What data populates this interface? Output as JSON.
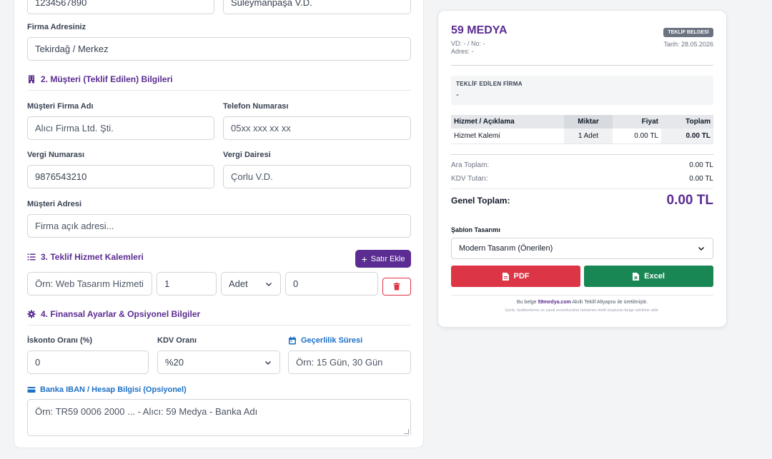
{
  "form": {
    "top_inputs": {
      "tax_number": "1234567890",
      "tax_office": "Süleymanpaşa V.D."
    },
    "company_address": {
      "label": "Firma Adresiniz",
      "value": "Tekirdağ / Merkez"
    },
    "section2": {
      "title": "2. Müşteri (Teklif Edilen) Bilgileri",
      "client_name": {
        "label": "Müşteri Firma Adı",
        "placeholder": "Alıcı Firma Ltd. Şti."
      },
      "phone": {
        "label": "Telefon Numarası",
        "placeholder": "05xx xxx xx xx"
      },
      "tax_number": {
        "label": "Vergi Numarası",
        "value": "9876543210"
      },
      "tax_office": {
        "label": "Vergi Dairesi",
        "placeholder": "Çorlu V.D."
      },
      "address": {
        "label": "Müşteri Adresi",
        "placeholder": "Firma açık adresi..."
      }
    },
    "section3": {
      "title": "3. Teklif Hizmet Kalemleri",
      "add_row_label": "Satır Ekle",
      "row": {
        "desc_placeholder": "Örn: Web Tasarım Hizmeti",
        "qty": "1",
        "unit": "Adet",
        "price": "0"
      }
    },
    "section4": {
      "title": "4. Finansal Ayarlar & Opsiyonel Bilgiler",
      "discount": {
        "label": "İskonto Oranı (%)",
        "value": "0"
      },
      "vat": {
        "label": "KDV Oranı",
        "value": "%20"
      },
      "validity": {
        "label": "Geçerlilik Süresi",
        "placeholder": "Örn: 15 Gün, 30 Gün"
      },
      "iban": {
        "label": "Banka IBAN / Hesap Bilgisi (Opsiyonel)",
        "placeholder": "Örn: TR59 0006 2000 ... - Alıcı: 59 Medya - Banka Adı"
      }
    }
  },
  "preview": {
    "brand": "59 MEDYA",
    "vd_line": "VD: - / No: -",
    "address_line": "Adres: -",
    "badge": "TEKLİF BELGESİ",
    "date": "Tarih: 28.05.2026",
    "client_title": "TEKLİF EDİLEN FİRMA",
    "client_value": "-",
    "table": {
      "headers": [
        "Hizmet / Açıklama",
        "Miktar",
        "Fiyat",
        "Toplam"
      ],
      "rows": [
        [
          "Hizmet Kalemi",
          "1 Adet",
          "0.00 TL",
          "0.00 TL"
        ]
      ]
    },
    "subtotal_label": "Ara Toplam:",
    "subtotal_value": "0.00 TL",
    "vat_label": "KDV Tutarı:",
    "vat_value": "0.00 TL",
    "grand_label": "Genel Toplam:",
    "grand_value": "0.00 TL",
    "template_label": "Şablon Tasarımı",
    "template_value": "Modern Tasarım (Önerilen)",
    "pdf_label": "PDF",
    "excel_label": "Excel",
    "footer_pre": "Bu belge",
    "footer_link": "59medya.com",
    "footer_post": "Akıllı Teklif Altyapısı ile üretilmiştir.",
    "footer_small": "İçerik, fiyatlandırma ve yasal sorumluluklar tamamen teklif oluşturan belge sahibine aittir."
  },
  "colors": {
    "brand": "#5b2c91",
    "pdf": "#dc3545",
    "excel": "#198754",
    "link_blue": "#1d70c7"
  }
}
